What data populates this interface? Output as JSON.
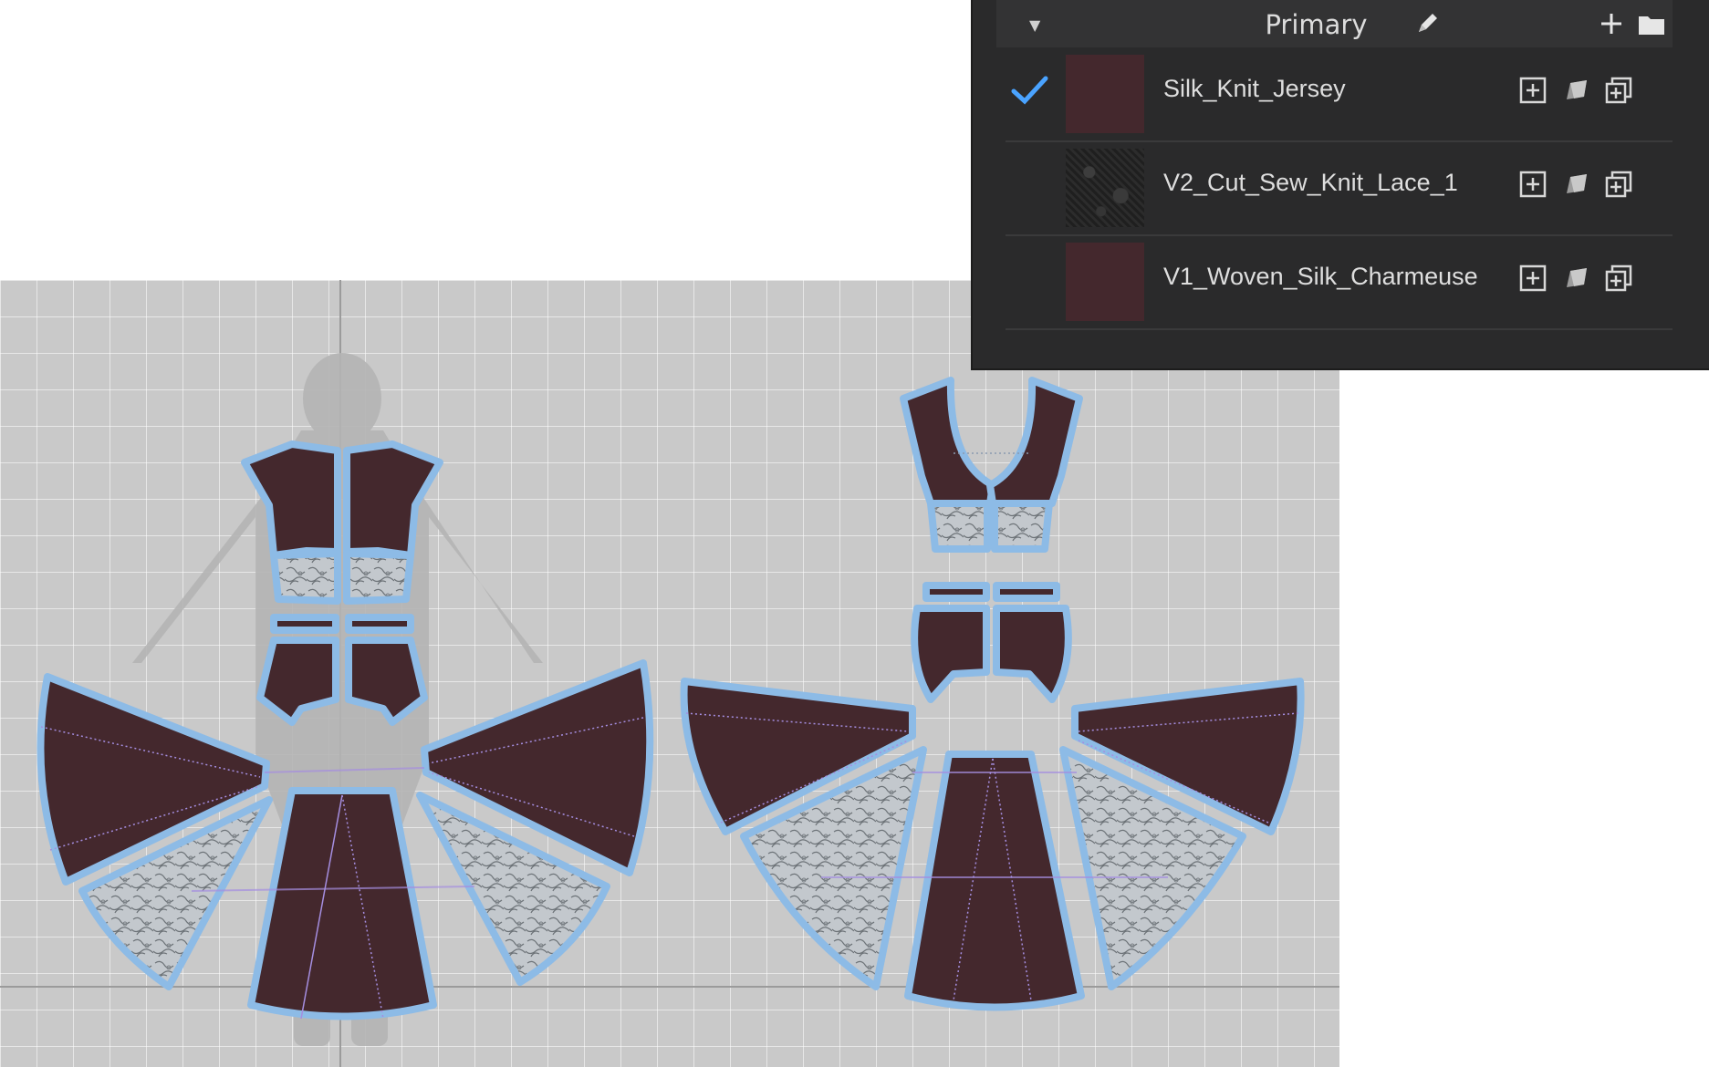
{
  "colorway": {
    "title": "Primary",
    "icons": {
      "collapse": "triangle-down-icon",
      "edit": "pencil-icon",
      "add": "plus-icon",
      "folder": "folder-icon"
    }
  },
  "fabrics": [
    {
      "name": "Silk_Knit_Jersey",
      "selected": true,
      "swatch_color": "#44282d",
      "swatch_kind": "solid"
    },
    {
      "name": "V2_Cut_Sew_Knit_Lace_1",
      "selected": false,
      "swatch_color": "#2a2a2a",
      "swatch_kind": "lace"
    },
    {
      "name": "V1_Woven_Silk_Charmeuse",
      "selected": false,
      "swatch_color": "#44282d",
      "swatch_kind": "solid"
    }
  ],
  "row_icons": [
    "add-to-pattern-icon",
    "apply-fabric-icon",
    "duplicate-icon"
  ],
  "colors": {
    "panel_bg": "#2a2a2b",
    "header_bg": "#333334",
    "check": "#4aa3ff",
    "canvas_bg": "#c9c9c9",
    "piece_fill": "#44282d",
    "piece_outline": "#8dbbe6",
    "lace_fill": "#c2c7cc",
    "seam_line": "#a58ee0"
  }
}
